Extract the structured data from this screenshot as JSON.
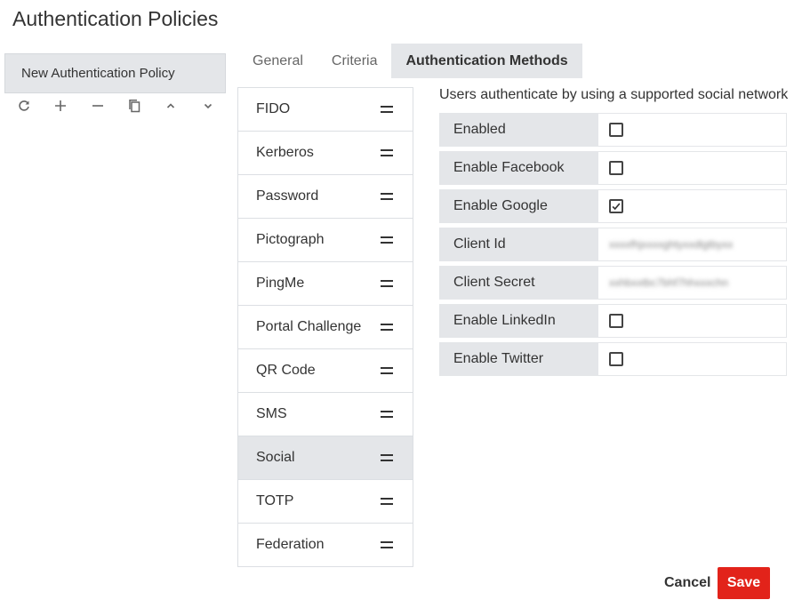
{
  "page": {
    "title": "Authentication Policies"
  },
  "policies": {
    "items": [
      {
        "label": "New Authentication Policy"
      }
    ],
    "toolbar": [
      "refresh-icon",
      "plus-icon",
      "minus-icon",
      "copy-icon",
      "chevron-up-icon",
      "chevron-down-icon"
    ]
  },
  "tabs": [
    {
      "label": "General",
      "active": false
    },
    {
      "label": "Criteria",
      "active": false
    },
    {
      "label": "Authentication Methods",
      "active": true
    }
  ],
  "methods": [
    {
      "label": "FIDO"
    },
    {
      "label": "Kerberos"
    },
    {
      "label": "Password"
    },
    {
      "label": "Pictograph"
    },
    {
      "label": "PingMe"
    },
    {
      "label": "Portal Challenge"
    },
    {
      "label": "QR Code"
    },
    {
      "label": "SMS"
    },
    {
      "label": "Social",
      "selected": true
    },
    {
      "label": "TOTP"
    },
    {
      "label": "Federation"
    }
  ],
  "settings": {
    "description": "Users authenticate by using a supported social network",
    "rows": [
      {
        "label": "Enabled",
        "type": "checkbox",
        "checked": false
      },
      {
        "label": "Enable Facebook",
        "type": "checkbox",
        "checked": false
      },
      {
        "label": "Enable Google",
        "type": "checkbox",
        "checked": true
      },
      {
        "label": "Client Id",
        "type": "text",
        "value": "xxxxfhjxxxxghtyxxdlgtbyxx"
      },
      {
        "label": "Client Secret",
        "type": "text",
        "value": "xxhbxxtbc7bhf7hhxxxchn"
      },
      {
        "label": "Enable LinkedIn",
        "type": "checkbox",
        "checked": false
      },
      {
        "label": "Enable Twitter",
        "type": "checkbox",
        "checked": false
      }
    ]
  },
  "footer": {
    "cancel_label": "Cancel",
    "save_label": "Save"
  },
  "colors": {
    "accent": "#e2231a",
    "panel": "#e4e6e9",
    "border": "#dcdfe3"
  }
}
